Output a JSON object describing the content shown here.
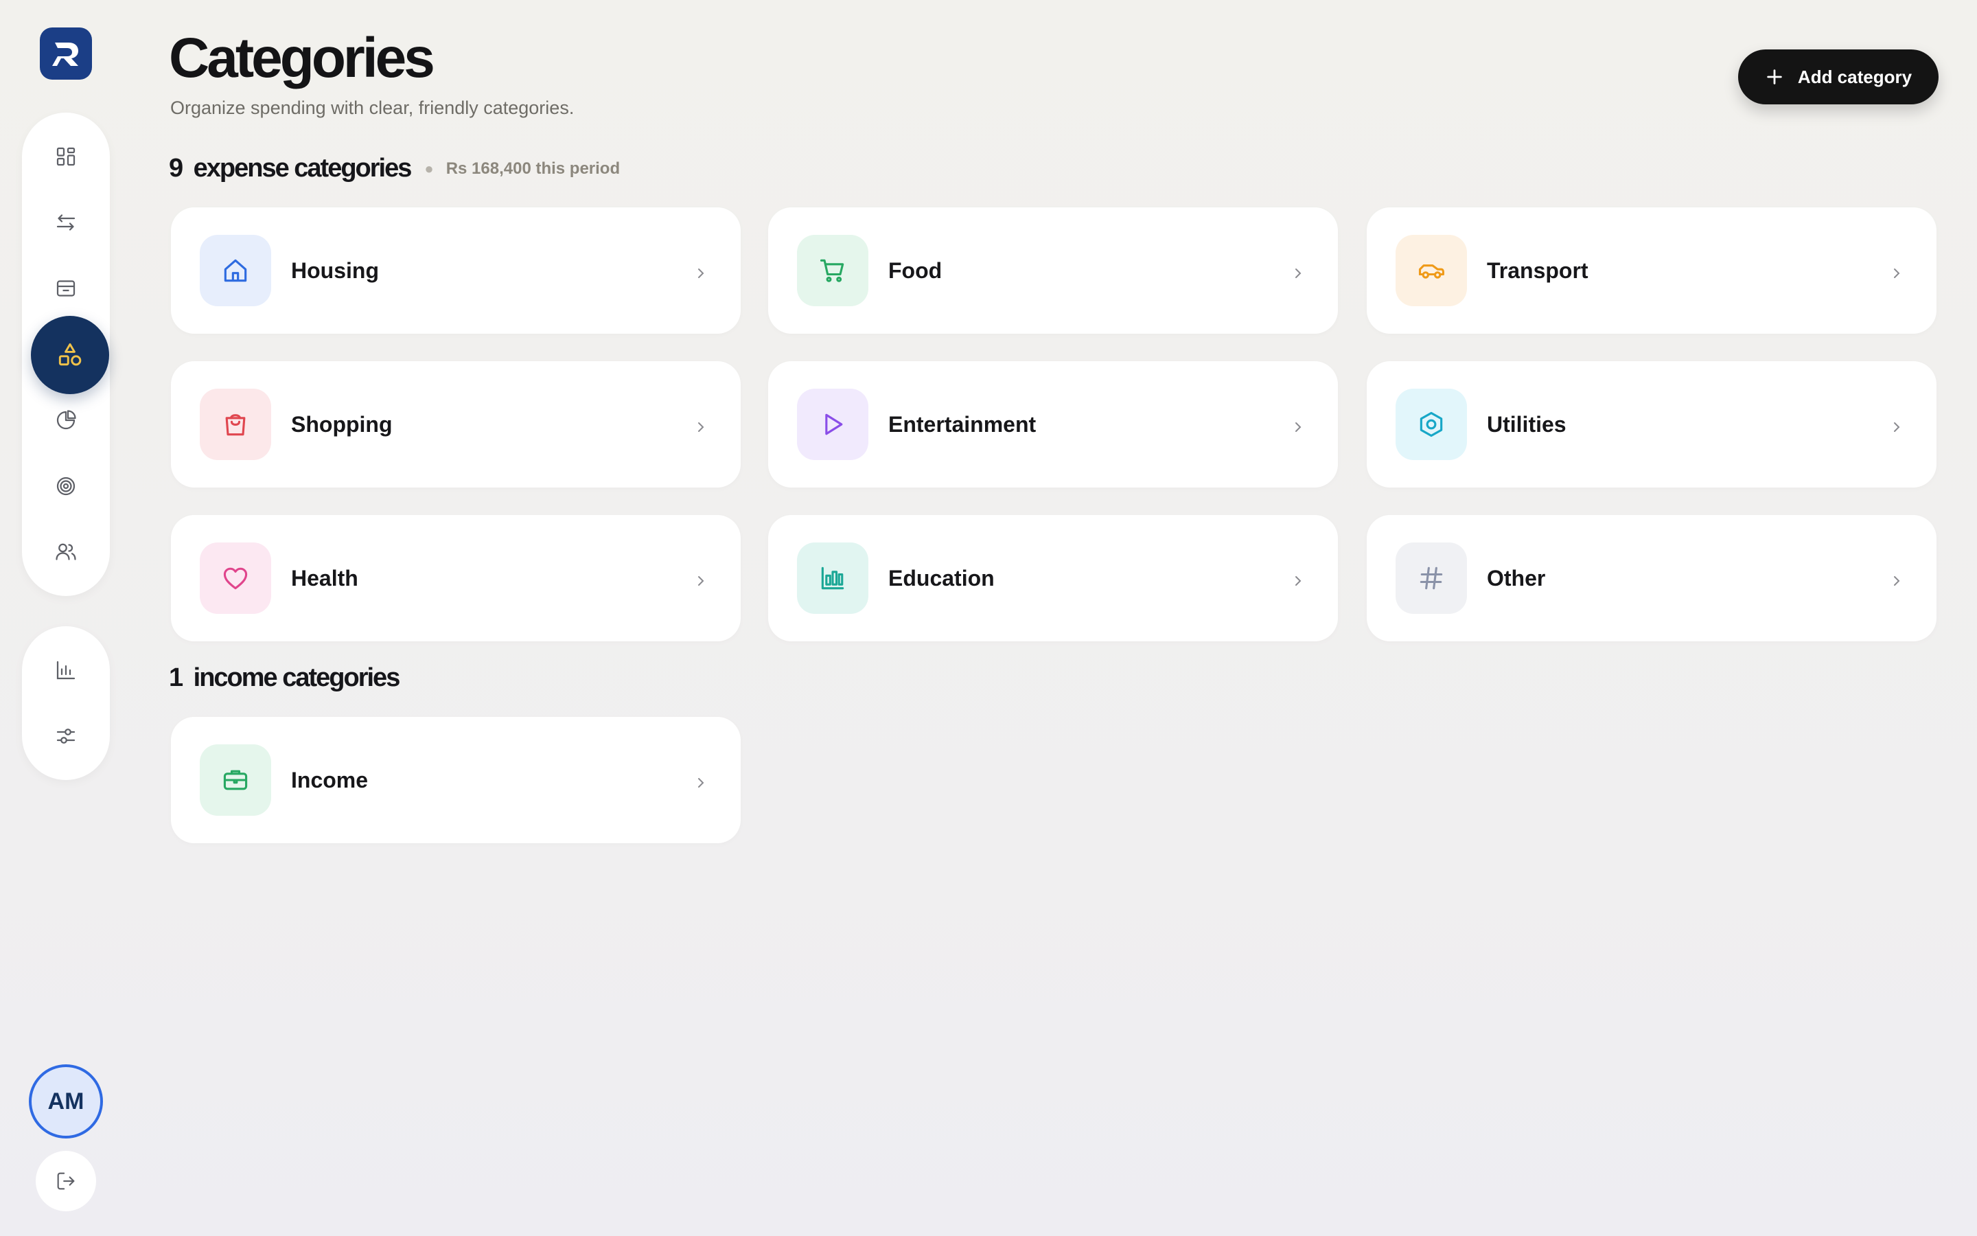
{
  "app": {
    "logo_letter": "R",
    "brand_color": "#1b3e86",
    "accent_dark": "#14325f"
  },
  "page": {
    "title": "Categories",
    "subtitle": "Organize spending with clear, friendly categories."
  },
  "actions": {
    "add_label": "Add category",
    "add_icon": "plus-icon"
  },
  "sidebar": {
    "main_items": [
      {
        "icon": "dashboard-icon",
        "active": false
      },
      {
        "icon": "transfer-arrows-icon",
        "active": false
      },
      {
        "icon": "inbox-icon",
        "active": false
      },
      {
        "icon": "shapes-icon",
        "active": true
      },
      {
        "icon": "pie-chart-icon",
        "active": false
      },
      {
        "icon": "target-icon",
        "active": false
      },
      {
        "icon": "users-icon",
        "active": false
      }
    ],
    "secondary_items": [
      {
        "icon": "bar-chart-icon"
      },
      {
        "icon": "sliders-icon"
      }
    ],
    "user_initials": "AM",
    "logout_icon": "logout-icon"
  },
  "expense": {
    "count": "9",
    "label": "expense categories",
    "total": "Rs 168,400 this period",
    "items": [
      {
        "name": "Housing",
        "icon": "house-icon",
        "color": "#2e6be0",
        "bg": "#e7eefc"
      },
      {
        "name": "Food",
        "icon": "cart-icon",
        "color": "#27a862",
        "bg": "#e5f6ec"
      },
      {
        "name": "Transport",
        "icon": "car-icon",
        "color": "#ef9a18",
        "bg": "#fdf1e2"
      },
      {
        "name": "Shopping",
        "icon": "shopping-bag-icon",
        "color": "#e0464f",
        "bg": "#fce8ea"
      },
      {
        "name": "Entertainment",
        "icon": "play-icon",
        "color": "#8a4ee8",
        "bg": "#f1eafd"
      },
      {
        "name": "Utilities",
        "icon": "hexagon-nut-icon",
        "color": "#17a7c7",
        "bg": "#e2f6fb"
      },
      {
        "name": "Health",
        "icon": "heart-icon",
        "color": "#e0458c",
        "bg": "#fce8f2"
      },
      {
        "name": "Education",
        "icon": "bar-chart-icon",
        "color": "#1ba796",
        "bg": "#e1f5f1"
      },
      {
        "name": "Other",
        "icon": "hash-icon",
        "color": "#8a92a8",
        "bg": "#f0f1f4"
      }
    ]
  },
  "income": {
    "count": "1",
    "label": "income categories",
    "items": [
      {
        "name": "Income",
        "icon": "briefcase-icon",
        "color": "#27a862",
        "bg": "#e5f6ec"
      }
    ]
  }
}
